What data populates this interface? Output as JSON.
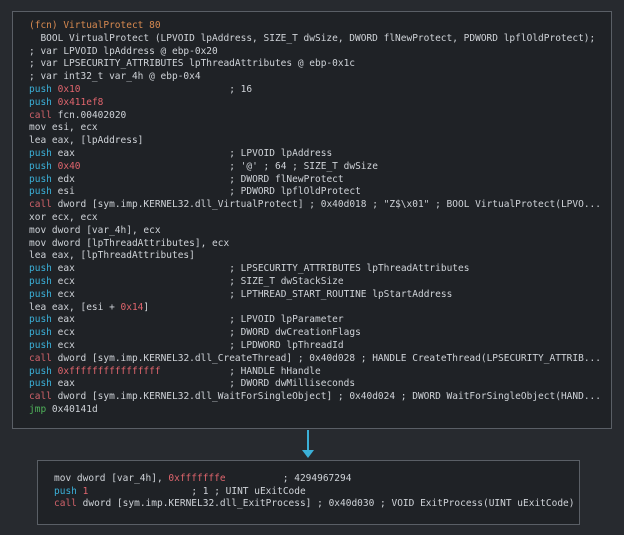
{
  "nodes": [
    {
      "id": "block-0x40409c",
      "lines": [
        {
          "type": "header",
          "text": "(fcn) VirtualProtect 80"
        },
        {
          "type": "sig",
          "text": "  BOOL VirtualProtect (LPVOID lpAddress, SIZE_T dwSize, DWORD flNewProtect, PDWORD lpflOldProtect);"
        },
        {
          "type": "comment",
          "text": "; var LPVOID lpAddress @ ebp-0x20"
        },
        {
          "type": "comment",
          "text": "; var LPSECURITY_ATTRIBUTES lpThreadAttributes @ ebp-0x1c"
        },
        {
          "type": "comment",
          "text": "; var int32_t var_4h @ ebp-0x4"
        },
        {
          "type": "push",
          "op": "push",
          "arg": "0x10",
          "arg_imm": true,
          "cmt": "; 16"
        },
        {
          "type": "push",
          "op": "push",
          "arg": "0x411ef8",
          "arg_imm": true,
          "cmt": ""
        },
        {
          "type": "call",
          "op": "call",
          "arg": "fcn.00402020",
          "cmt": ""
        },
        {
          "type": "plain",
          "text": "mov esi, ecx"
        },
        {
          "type": "plain",
          "text": "lea eax, [lpAddress]"
        },
        {
          "type": "push",
          "op": "push",
          "arg": "eax",
          "arg_imm": false,
          "cmt": "; LPVOID lpAddress"
        },
        {
          "type": "push",
          "op": "push",
          "arg": "0x40",
          "arg_imm": true,
          "cmt": "; '@' ; 64 ; SIZE_T dwSize"
        },
        {
          "type": "push",
          "op": "push",
          "arg": "edx",
          "arg_imm": false,
          "cmt": "; DWORD flNewProtect"
        },
        {
          "type": "push",
          "op": "push",
          "arg": "esi",
          "arg_imm": false,
          "cmt": "; PDWORD lpflOldProtect"
        },
        {
          "type": "call",
          "op": "call",
          "arg": "dword [sym.imp.KERNEL32.dll_VirtualProtect] ; 0x40d018 ; \"Z$\\x01\" ; BOOL VirtualProtect(LPVO...",
          "cmt": ""
        },
        {
          "type": "plain",
          "text": "xor ecx, ecx"
        },
        {
          "type": "plain",
          "text": "mov dword [var_4h], ecx"
        },
        {
          "type": "plain",
          "text": "mov dword [lpThreadAttributes], ecx"
        },
        {
          "type": "plain",
          "text": "lea eax, [lpThreadAttributes]"
        },
        {
          "type": "push",
          "op": "push",
          "arg": "eax",
          "arg_imm": false,
          "cmt": "; LPSECURITY_ATTRIBUTES lpThreadAttributes"
        },
        {
          "type": "push",
          "op": "push",
          "arg": "ecx",
          "arg_imm": false,
          "cmt": "; SIZE_T dwStackSize"
        },
        {
          "type": "push",
          "op": "push",
          "arg": "ecx",
          "arg_imm": false,
          "cmt": "; LPTHREAD_START_ROUTINE lpStartAddress"
        },
        {
          "type": "lea_imm",
          "pre": "lea eax, [esi + ",
          "imm": "0x14",
          "post": "]"
        },
        {
          "type": "push",
          "op": "push",
          "arg": "eax",
          "arg_imm": false,
          "cmt": "; LPVOID lpParameter"
        },
        {
          "type": "push",
          "op": "push",
          "arg": "ecx",
          "arg_imm": false,
          "cmt": "; DWORD dwCreationFlags"
        },
        {
          "type": "push",
          "op": "push",
          "arg": "ecx",
          "arg_imm": false,
          "cmt": "; LPDWORD lpThreadId"
        },
        {
          "type": "call",
          "op": "call",
          "arg": "dword [sym.imp.KERNEL32.dll_CreateThread] ; 0x40d028 ; HANDLE CreateThread(LPSECURITY_ATTRIB...",
          "cmt": ""
        },
        {
          "type": "push",
          "op": "push",
          "arg": "0xffffffffffffffff",
          "arg_imm": true,
          "cmt": "; HANDLE hHandle"
        },
        {
          "type": "push",
          "op": "push",
          "arg": "eax",
          "arg_imm": false,
          "cmt": "; DWORD dwMilliseconds"
        },
        {
          "type": "call",
          "op": "call",
          "arg": "dword [sym.imp.KERNEL32.dll_WaitForSingleObject] ; 0x40d024 ; DWORD WaitForSingleObject(HAND...",
          "cmt": ""
        },
        {
          "type": "jmp",
          "op": "jmp",
          "arg": "0x40141d"
        }
      ]
    },
    {
      "id": "block-exit",
      "lines": [
        {
          "type": "mov_imm",
          "pre": "mov dword [var_4h], ",
          "imm": "0xfffffffe",
          "cmt": "; 4294967294"
        },
        {
          "type": "push",
          "op": "push",
          "arg": "1",
          "arg_imm": true,
          "cmt": "; 1 ; UINT uExitCode"
        },
        {
          "type": "call",
          "op": "call",
          "arg": "dword [sym.imp.KERNEL32.dll_ExitProcess] ; 0x40d030 ; VOID ExitProcess(UINT uExitCode)",
          "cmt": ""
        }
      ]
    }
  ],
  "colors": {
    "push": "#3bb0d8",
    "call": "#d0626a",
    "jmp": "#4fb35a",
    "immediate": "#e0656d",
    "header": "#d88a50",
    "edge": "#3bb0d8"
  }
}
